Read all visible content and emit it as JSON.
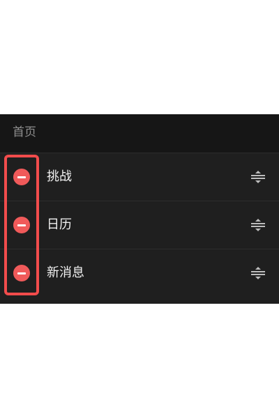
{
  "section": {
    "title": "首页"
  },
  "items": [
    {
      "label": "挑战",
      "remove_icon": "minus-circle-icon",
      "drag_icon": "drag-handle-icon"
    },
    {
      "label": "日历",
      "remove_icon": "minus-circle-icon",
      "drag_icon": "drag-handle-icon"
    },
    {
      "label": "新消息",
      "remove_icon": "minus-circle-icon",
      "drag_icon": "drag-handle-icon"
    }
  ],
  "colors": {
    "background": "#1f1f1f",
    "header_background": "#161616",
    "remove_red": "#f05a5a",
    "highlight_red": "#f24c4c",
    "text": "#f2f2f2",
    "muted_text": "#8f8f8f"
  }
}
